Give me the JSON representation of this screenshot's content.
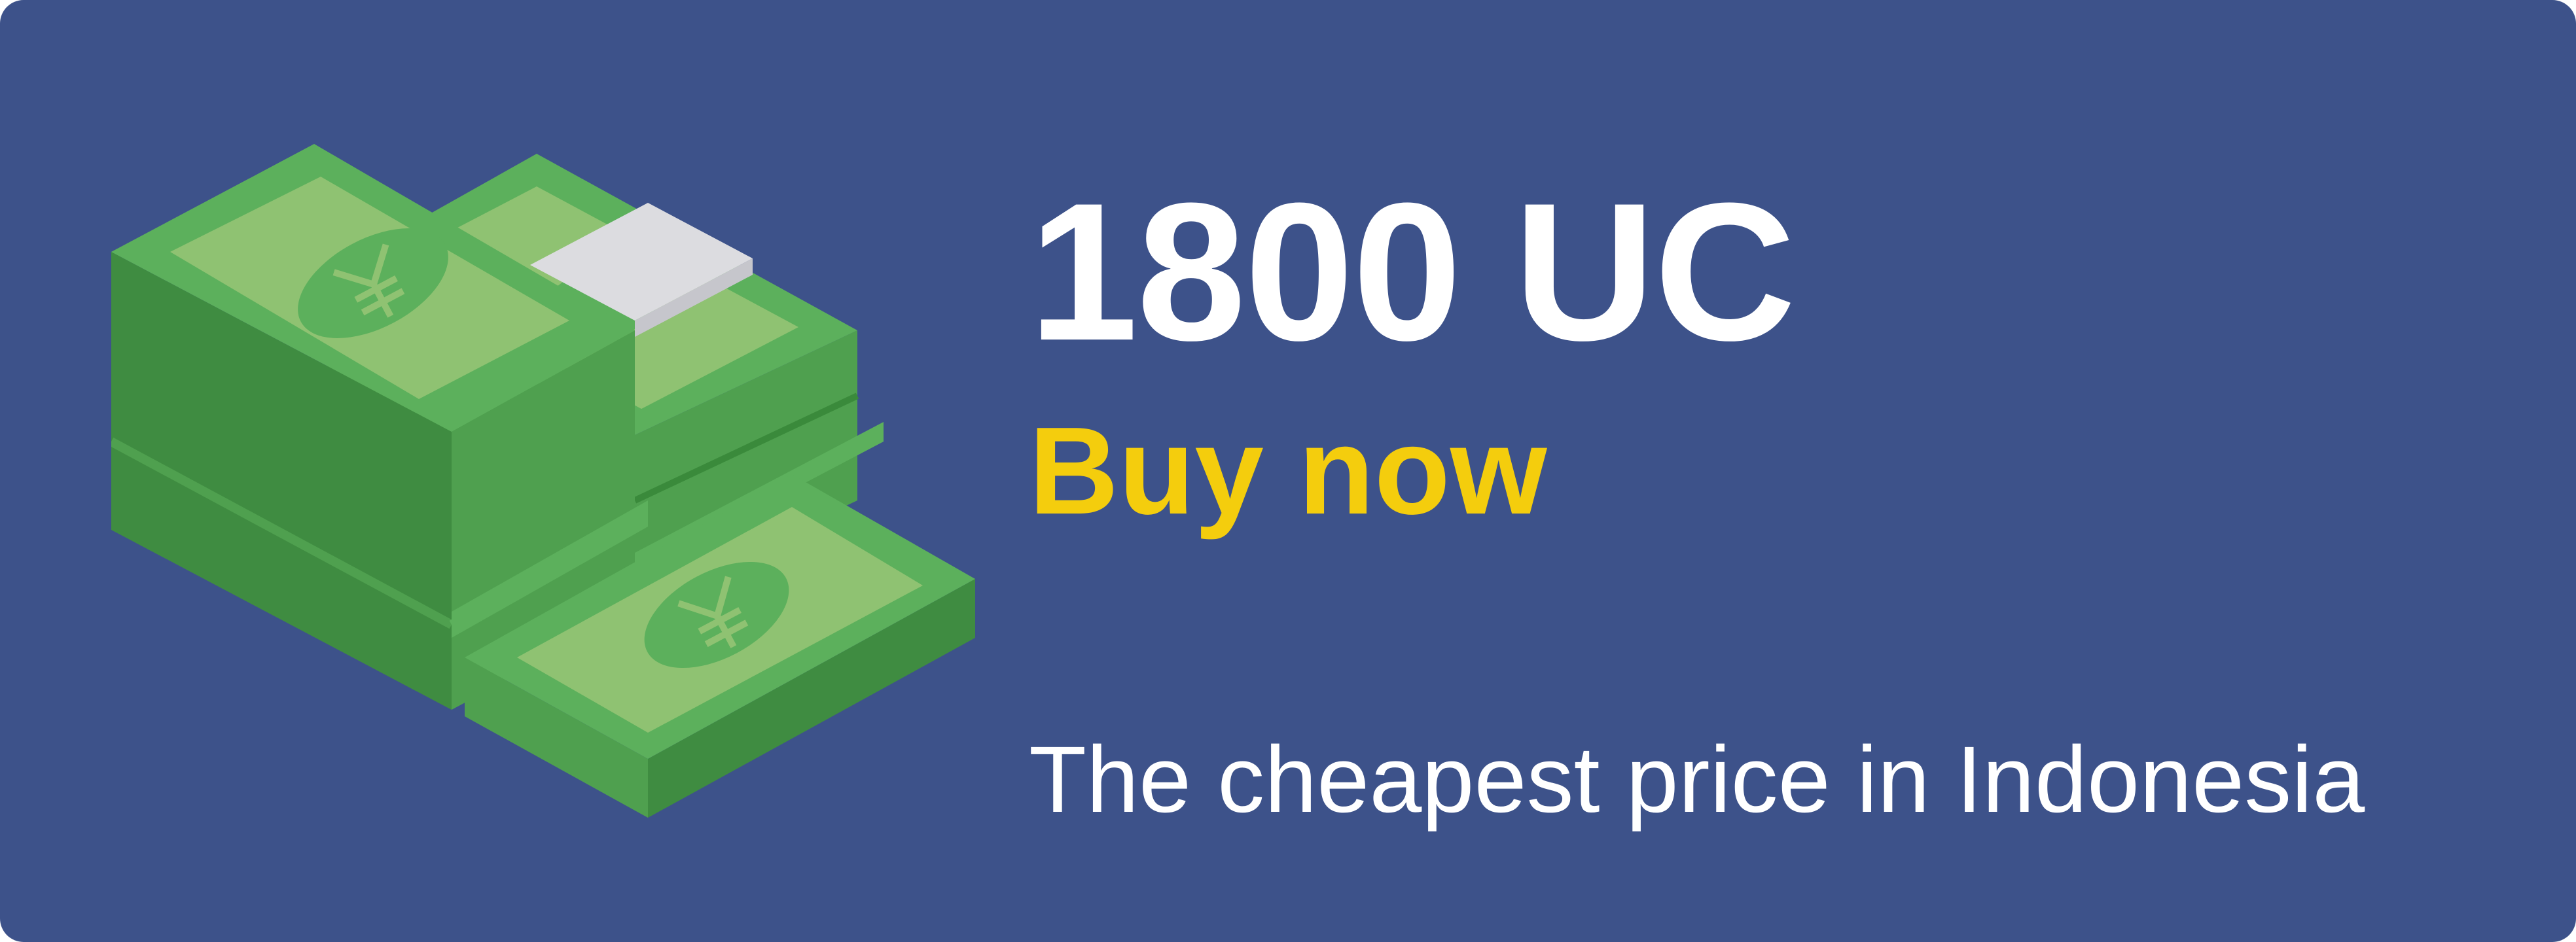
{
  "banner": {
    "title": "1800 UC",
    "cta_label": "Buy now",
    "tagline": "The cheapest price in Indonesia",
    "illustration": "money-stacks-yen-icon",
    "colors": {
      "background": "#3d528a",
      "title": "#ffffff",
      "cta": "#f4cd0d",
      "tagline": "#ffffff",
      "bill_face": "#5cb05c",
      "bill_side": "#3f8c41",
      "bill_center": "#8fc272",
      "band": "#dcdce0"
    }
  }
}
